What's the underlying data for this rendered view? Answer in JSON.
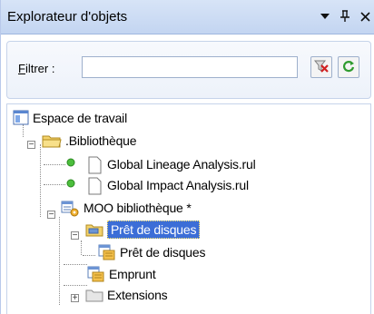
{
  "panel": {
    "title": "Explorateur d'objets",
    "title_icons": [
      "dropdown-arrow-icon",
      "pin-icon",
      "close-icon"
    ]
  },
  "filter": {
    "label_prefix": "F",
    "label_rest": "iltrer :",
    "value": "",
    "clear_icon": "filter-clear-icon",
    "refresh_icon": "refresh-icon"
  },
  "tree": {
    "workspace": "Espace de travail",
    "library": ".Bibliothèque",
    "items": {
      "gla": "Global Lineage Analysis.rul",
      "gia": "Global Impact Analysis.rul",
      "moo": "MOO bibliothèque *",
      "pret_pkg": "Prêt de disques",
      "pret_diag": "Prêt de disques",
      "emprunt": "Emprunt",
      "extensions": "Extensions"
    }
  }
}
